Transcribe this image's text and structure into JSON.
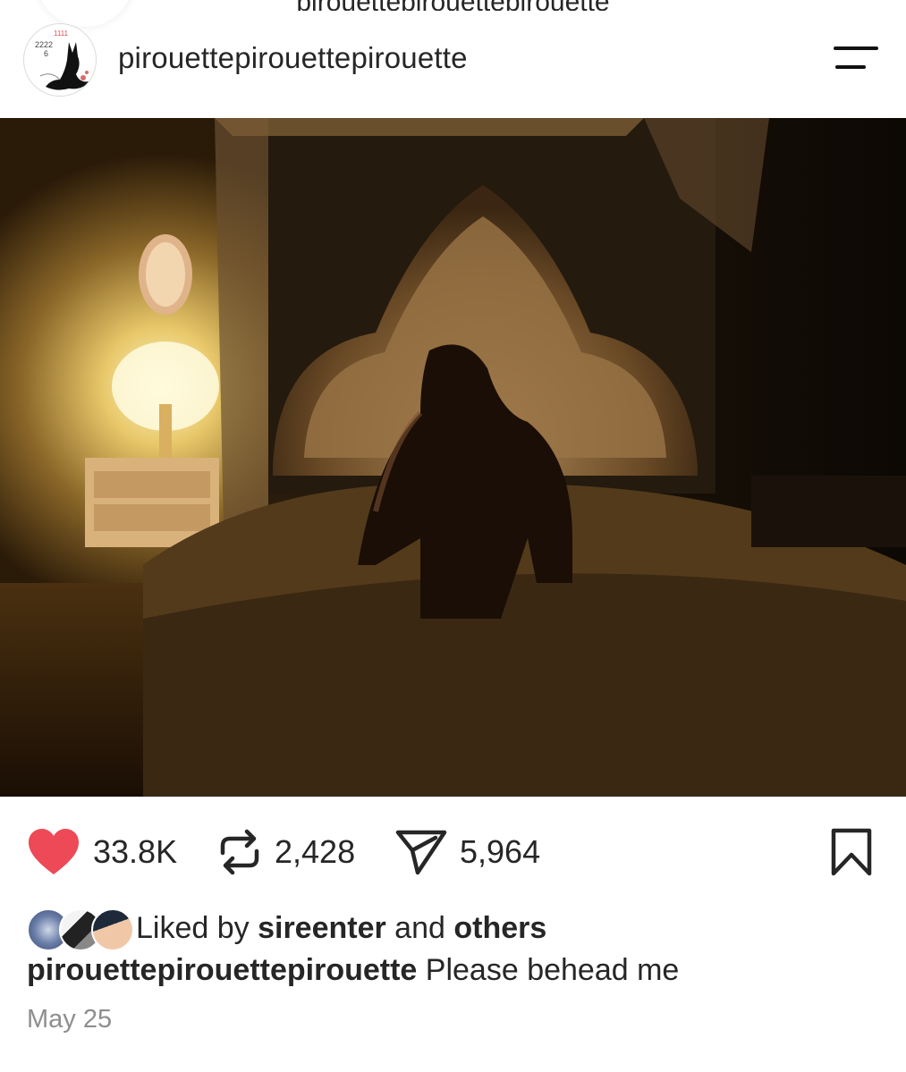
{
  "top_cutoff_text": "pirouettepirouettepirouette",
  "profile": {
    "username": "pirouettepirouettepirouette",
    "avatar_text": [
      "1111",
      "2222",
      "6"
    ]
  },
  "post": {
    "photo_icon": "bedroom-photo"
  },
  "actions": {
    "likes": "33.8K",
    "reposts": "2,428",
    "shares": "5,964",
    "like_icon": "heart-icon",
    "repost_icon": "repost-icon",
    "share_icon": "send-icon",
    "bookmark_icon": "bookmark-icon",
    "like_color": "#ed4956"
  },
  "liked_by": {
    "prefix": "Liked by ",
    "user": "sireenter",
    "middle": " and ",
    "others": "others"
  },
  "caption": {
    "user": "pirouettepirouettepirouette",
    "text": " Please behead me"
  },
  "date": "May 25"
}
